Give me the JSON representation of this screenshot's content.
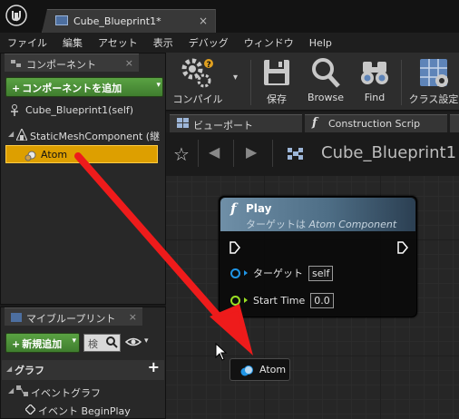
{
  "window": {
    "doc_tab_label": "Cube_Blueprint1*",
    "doc_tab_close": "×"
  },
  "menu": [
    "ファイル",
    "編集",
    "アセット",
    "表示",
    "デバッグ",
    "ウィンドウ",
    "Help"
  ],
  "components_panel": {
    "tab_label": "コンポーネント",
    "tab_close": "×",
    "add_button_label": "コンポーネントを追加",
    "add_button_plus": "+",
    "root_item": "Cube_Blueprint1(self)",
    "mesh_item": "StaticMeshComponent (継",
    "selected_item": "Atom"
  },
  "my_blueprint_panel": {
    "tab_label": "マイブループリント",
    "tab_close": "×",
    "new_button_label": "新規追加",
    "new_button_plus": "+",
    "search_placeholder": "検",
    "graphs_header": "グラフ",
    "graphs_add": "+",
    "event_graph_label": "イベントグラフ",
    "begin_play_label": "イベント BeginPlay"
  },
  "toolbar": {
    "compile_label": "コンパイル",
    "save_label": "保存",
    "browse_label": "Browse",
    "find_label": "Find",
    "class_settings_label": "クラス設定"
  },
  "editor_tabs": {
    "viewport_label": "ビューポート",
    "construction_label": "Construction Scrip"
  },
  "graph": {
    "breadcrumb_title": "Cube_Blueprint1",
    "play_node": {
      "function_glyph": "f",
      "title": "Play",
      "subtitle_prefix": "ターゲットは ",
      "subtitle_target": "Atom Component",
      "target_label": "ターゲット",
      "target_value": "self",
      "start_time_label": "Start Time",
      "start_time_value": "0.0"
    },
    "atom_node_label": "Atom"
  },
  "colors": {
    "selection": "#dd9f00",
    "node_header": "#5a7a92",
    "object_pin": "#1f95e6",
    "float_pin": "#9be024",
    "annotation_arrow": "#ee1b1b",
    "button_green": "#4a8e37"
  }
}
